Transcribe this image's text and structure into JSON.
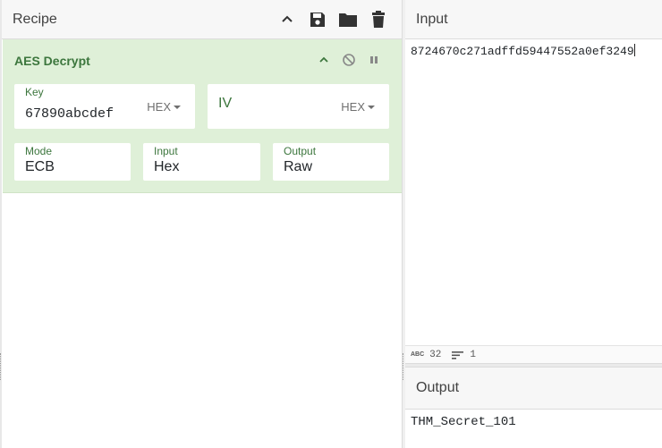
{
  "recipe": {
    "title": "Recipe",
    "header_icons": [
      "chevron-up-icon",
      "save-icon",
      "folder-icon",
      "trash-icon"
    ]
  },
  "operation": {
    "title": "AES Decrypt",
    "icons": [
      "chevron-up-icon",
      "disable-icon",
      "pause-icon"
    ],
    "key": {
      "label": "Key",
      "value": "67890abcdef",
      "format": "HEX"
    },
    "iv": {
      "label": "IV",
      "value": "",
      "format": "HEX"
    },
    "mode": {
      "label": "Mode",
      "value": "ECB"
    },
    "input": {
      "label": "Input",
      "value": "Hex"
    },
    "output": {
      "label": "Output",
      "value": "Raw"
    }
  },
  "input_panel": {
    "title": "Input",
    "text": "8724670c271adffd59447552a0ef3249",
    "stats": {
      "length": "32",
      "lines": "1"
    }
  },
  "output_panel": {
    "title": "Output",
    "text": "THM_Secret_101"
  },
  "colors": {
    "operation_bg": "#dff0d8",
    "operation_text": "#3c763d"
  }
}
